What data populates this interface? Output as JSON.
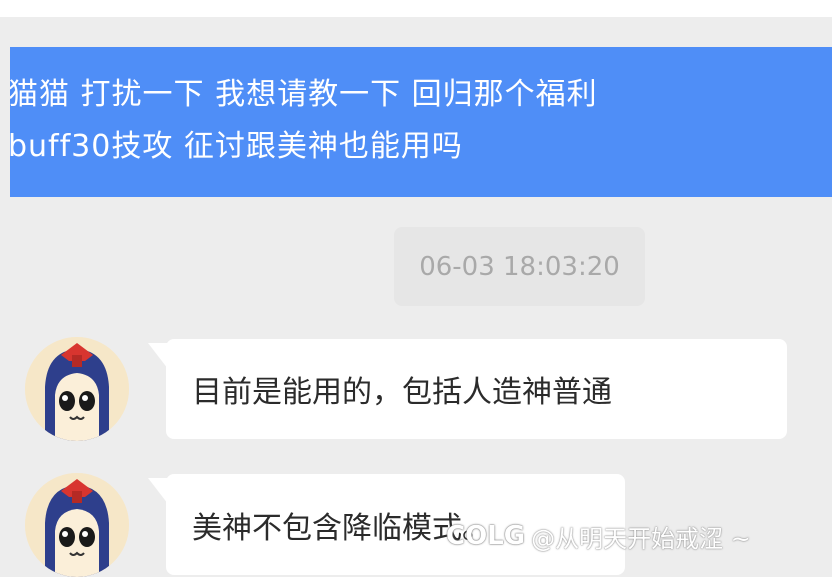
{
  "outgoing_message": {
    "line1": "猫猫  打扰一下   我想请教一下 回归那个福利",
    "line2": "buff30技攻 征讨跟美神也能用吗",
    "color": "#4f8ef7"
  },
  "timestamp": "06-03 18:03:20",
  "incoming_messages": [
    {
      "text": "目前是能用的，包括人造神普通"
    },
    {
      "text": "美神不包含降临模式。"
    }
  ],
  "watermark": {
    "logo": "COLG",
    "text": "@从明天开始戒涩 ~"
  },
  "avatar_icon": "pipimi-avatar-icon"
}
